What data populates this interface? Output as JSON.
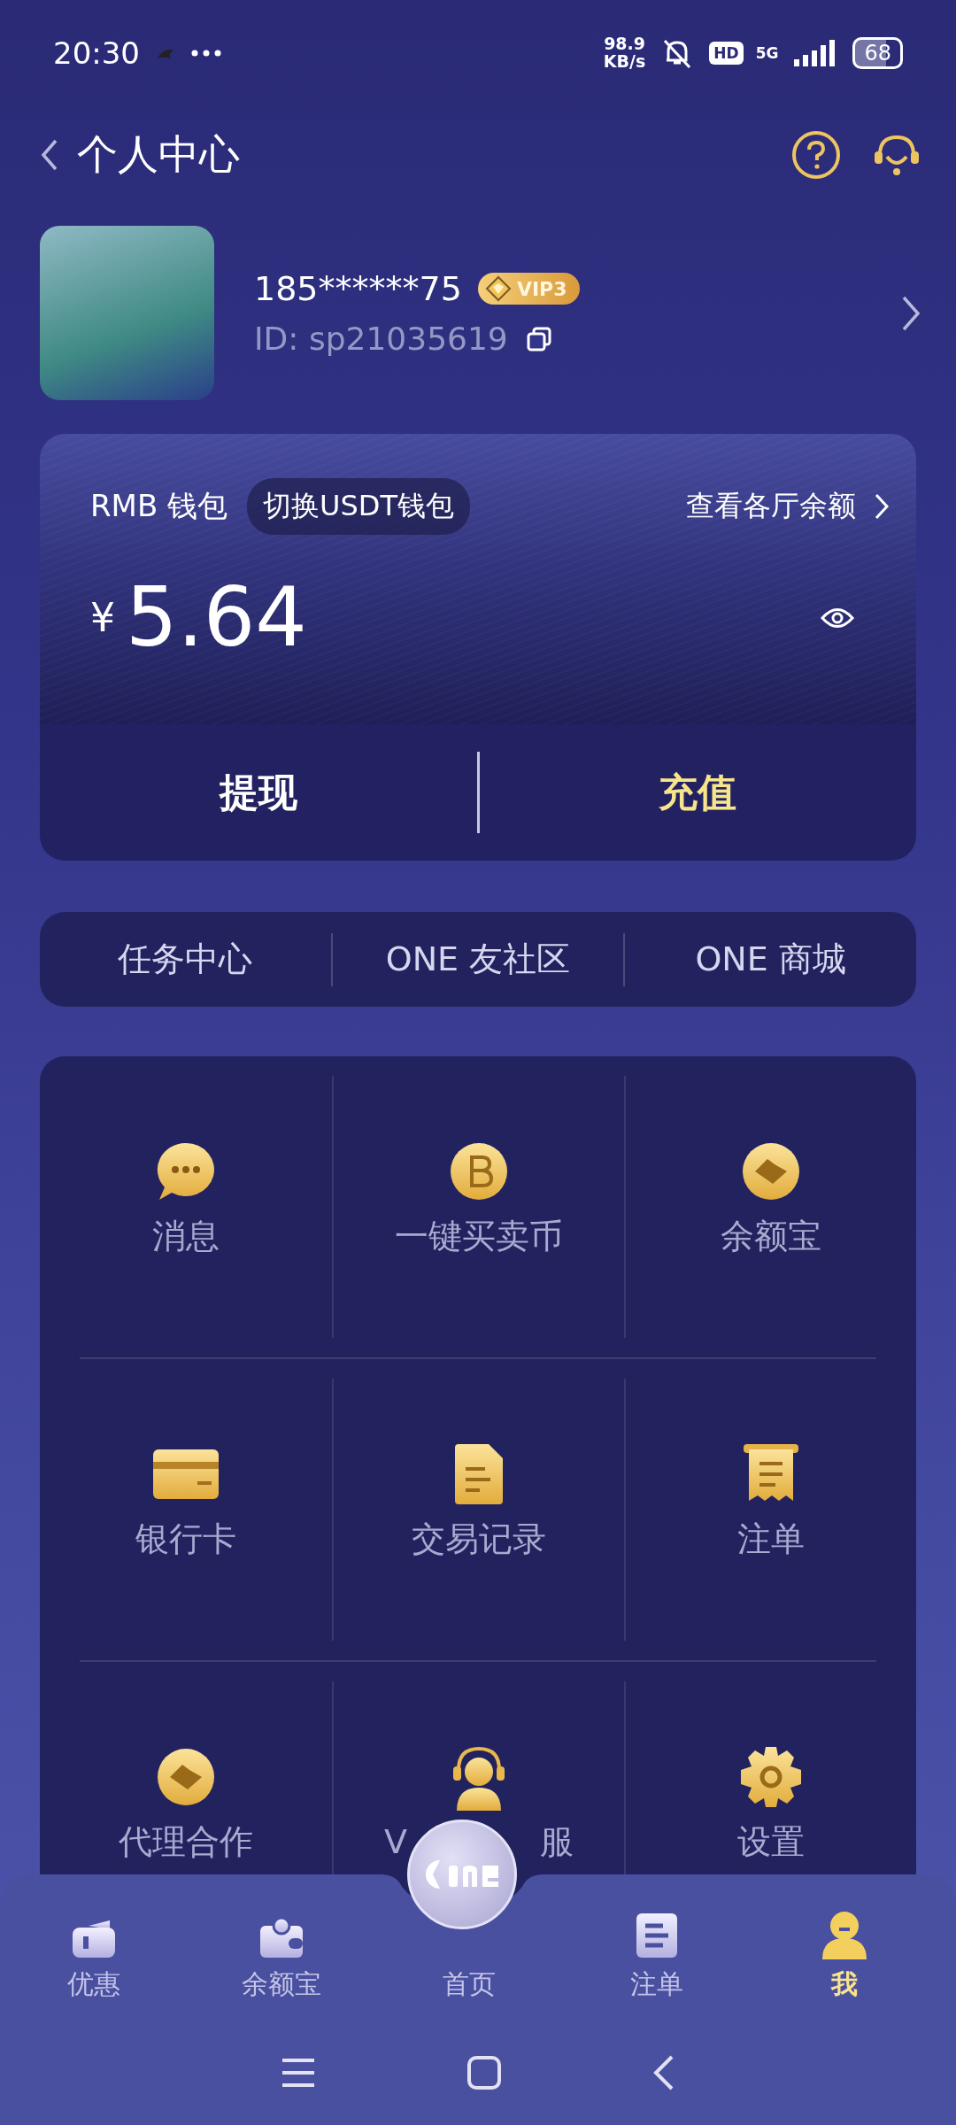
{
  "status_bar": {
    "time": "20:30",
    "net_speed": "98.9",
    "net_unit": "KB/s",
    "hd": "HD",
    "network": "5G",
    "battery": "68"
  },
  "header": {
    "title": "个人中心"
  },
  "profile": {
    "phone": "185******75",
    "vip": "VIP3",
    "id": "ID: sp21035619"
  },
  "wallet": {
    "title": "RMB 钱包",
    "switch": "切换USDT钱包",
    "balances_link": "查看各厅余额",
    "currency": "¥",
    "amount": "5.64",
    "actions": [
      {
        "label": "提现",
        "kind": "plain"
      },
      {
        "label": "充值",
        "kind": "highlight"
      }
    ]
  },
  "links": [
    "任务中心",
    "ONE 友社区",
    "ONE 商城"
  ],
  "menu": [
    {
      "label": "消息"
    },
    {
      "label": "一键买卖币"
    },
    {
      "label": "余额宝"
    },
    {
      "label": "银行卡"
    },
    {
      "label": "交易记录"
    },
    {
      "label": "注单"
    },
    {
      "label": "代理合作"
    },
    {
      "label_parts": [
        "V",
        "服"
      ]
    },
    {
      "label": "设置"
    }
  ],
  "tabs": [
    {
      "label": "优惠",
      "selected": false
    },
    {
      "label": "余额宝",
      "selected": false
    },
    {
      "label": "首页",
      "selected": false
    },
    {
      "label": "注单",
      "selected": false
    },
    {
      "label": "我",
      "selected": true
    }
  ]
}
